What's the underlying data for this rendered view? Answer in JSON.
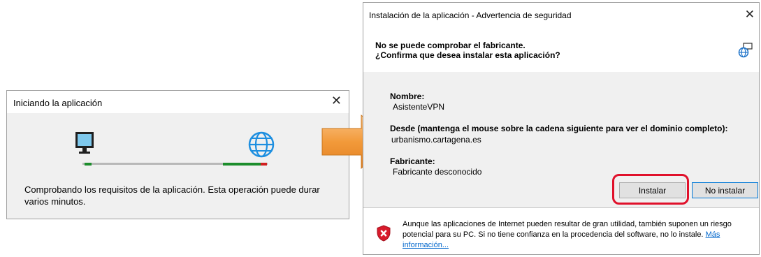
{
  "left_dialog": {
    "title": "Iniciando la aplicación",
    "close_glyph": "✕",
    "status_text": "Comprobando los requisitos de la aplicación. Esta operación puede durar varios minutos.",
    "icons": [
      "monitor-icon",
      "globe-icon"
    ]
  },
  "arrow": {
    "color": "#f5a042",
    "icon": "right-arrow-icon"
  },
  "right_dialog": {
    "title": "Instalación de la aplicación - Advertencia de seguridad",
    "close_glyph": "✕",
    "header_line1": "No se puede comprobar el fabricante.",
    "header_line2": "¿Confirma que desea instalar esta aplicación?",
    "name_label": "Nombre:",
    "name_value": "AsistenteVPN",
    "from_label": "Desde (mantenga el mouse sobre la cadena siguiente para ver el dominio completo):",
    "from_value": "urbanismo.cartagena.es",
    "publisher_label": "Fabricante:",
    "publisher_value": "Fabricante desconocido",
    "install_button": "Instalar",
    "no_install_button": "No instalar",
    "warning_text": "Aunque las aplicaciones de Internet pueden resultar de gran utilidad, también suponen un riesgo potencial para su PC. Si no tiene confianza en la procedencia del software, no lo instale.",
    "more_info_link": "Más información...",
    "icons": [
      "network-icon",
      "shield-warning-icon"
    ]
  },
  "colors": {
    "progress_green": "#1c8d2c",
    "progress_red": "#d11f1f",
    "highlight_ring": "#e0112b",
    "link": "#0066cc"
  }
}
